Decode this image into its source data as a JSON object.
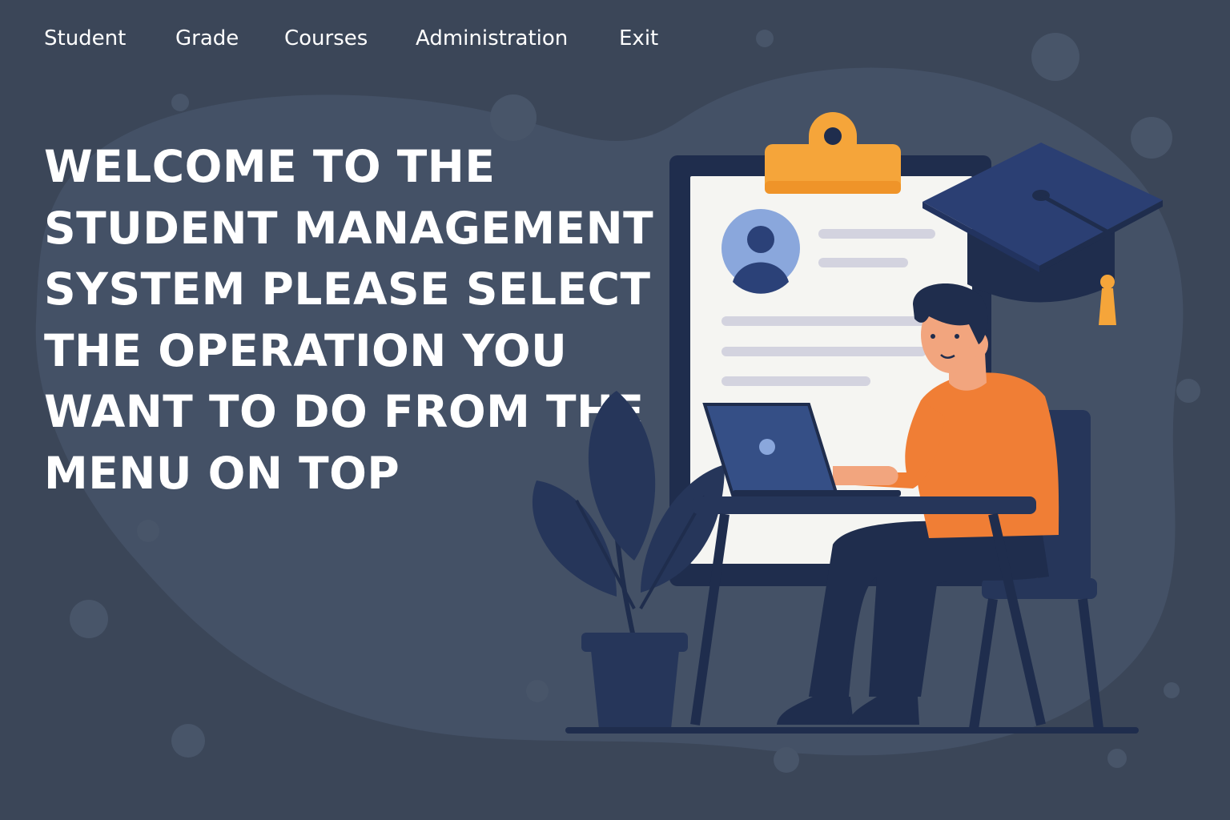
{
  "menu": {
    "items": [
      {
        "label": "Student"
      },
      {
        "label": "Grade"
      },
      {
        "label": "Courses"
      },
      {
        "label": "Administration"
      },
      {
        "label": "Exit"
      }
    ]
  },
  "main": {
    "welcome_text": "WELCOME TO THE STUDENT MANAGEMENT SYSTEM PLEASE SELECT THE OPERATION YOU WANT TO DO FROM THE MENU ON TOP"
  },
  "colors": {
    "background": "#3b4658",
    "background_blob": "#445166",
    "text": "#ffffff",
    "accent_orange": "#f5a53a",
    "shirt_orange": "#f07e35",
    "navy": "#1f2d4d",
    "laptop_blue": "#354f86",
    "avatar_blue": "#8aa7dc",
    "paper": "#f5f5f2"
  },
  "icons": [
    "graduation-cap-icon",
    "clipboard-icon",
    "avatar-icon",
    "laptop-icon",
    "plant-icon"
  ]
}
